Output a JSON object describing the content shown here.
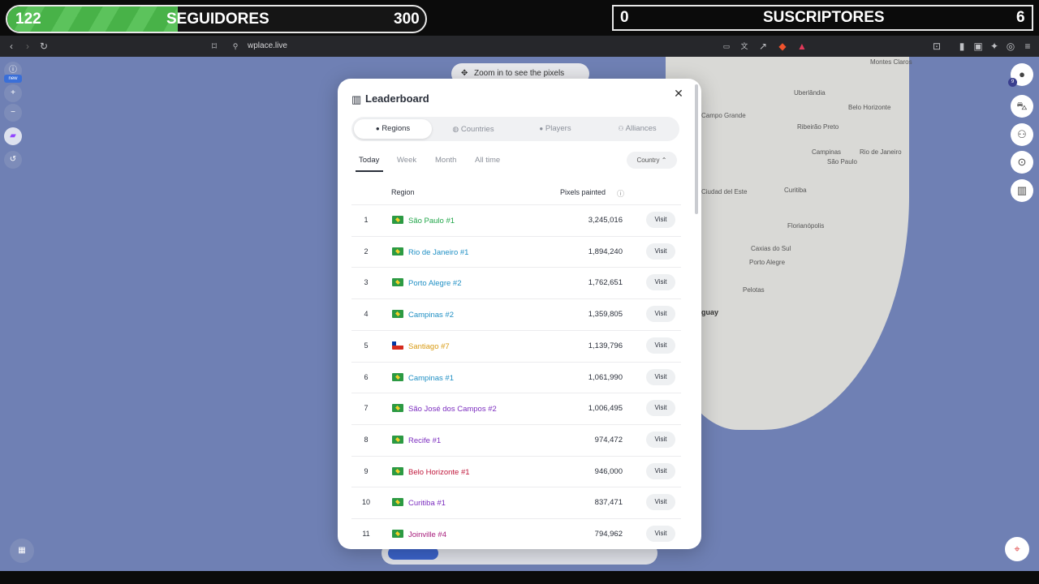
{
  "overlay": {
    "followers": {
      "current": "122",
      "label": "SEGUIDORES",
      "goal": "300",
      "progress": 0.407
    },
    "subscribers": {
      "current": "0",
      "label": "SUSCRIPTORES",
      "goal": "6"
    }
  },
  "browser": {
    "url": "wplace.live",
    "icons": [
      "back-icon",
      "forward-icon",
      "reload-icon",
      "bookmark-icon",
      "site-settings-icon",
      "cast-icon",
      "translate-icon",
      "share-icon",
      "brave-shield-icon",
      "rewards-icon",
      "tab-search-icon",
      "sidebar-icon",
      "wallet-icon",
      "leo-icon",
      "vpn-icon",
      "menu-icon"
    ]
  },
  "map": {
    "zoom_hint": "Zoom in to see the pixels",
    "cities": [
      "Montes Claros",
      "Uberlândia",
      "Belo Horizonte",
      "Campo Grande",
      "Ribeirão Preto",
      "Campinas",
      "Rio de Janeiro",
      "São Paulo",
      "Ciudad del Este",
      "Curitiba",
      "Florianópolis",
      "Caxias do Sul",
      "Porto Alegre",
      "Pelotas",
      "guay"
    ],
    "left_controls": [
      "info-icon",
      "new",
      "plus-icon",
      "minus-icon",
      "twitch-icon",
      "history-icon"
    ],
    "right_controls": [
      {
        "icon": "avatar-icon",
        "badge": "9"
      },
      {
        "icon": "cart-icon"
      },
      {
        "icon": "alliance-icon"
      },
      {
        "icon": "search-map-icon"
      },
      {
        "icon": "leaderboard-icon"
      }
    ]
  },
  "leaderboard": {
    "title": "Leaderboard",
    "close_icon": "close-icon",
    "tabs": [
      {
        "label": "Regions",
        "icon": "pin-icon",
        "active": true
      },
      {
        "label": "Countries",
        "icon": "globe-icon",
        "active": false
      },
      {
        "label": "Players",
        "icon": "person-icon",
        "active": false
      },
      {
        "label": "Alliances",
        "icon": "group-icon",
        "active": false
      }
    ],
    "periods": [
      {
        "label": "Today",
        "active": true
      },
      {
        "label": "Week",
        "active": false
      },
      {
        "label": "Month",
        "active": false
      },
      {
        "label": "All time",
        "active": false
      }
    ],
    "filter": "Country",
    "columns": {
      "region": "Region",
      "pixels": "Pixels painted"
    },
    "visit_label": "Visit",
    "rows": [
      {
        "rank": "1",
        "flag": "br",
        "name": "São Paulo #1",
        "color": "#22a64a",
        "pixels": "3,245,016"
      },
      {
        "rank": "2",
        "flag": "br",
        "name": "Rio de Janeiro #1",
        "color": "#1f8fc4",
        "pixels": "1,894,240"
      },
      {
        "rank": "3",
        "flag": "br",
        "name": "Porto Alegre #2",
        "color": "#1f8fc4",
        "pixels": "1,762,651"
      },
      {
        "rank": "4",
        "flag": "br",
        "name": "Campinas #2",
        "color": "#1f8fc4",
        "pixels": "1,359,805"
      },
      {
        "rank": "5",
        "flag": "cl",
        "name": "Santiago #7",
        "color": "#d89a12",
        "pixels": "1,139,796"
      },
      {
        "rank": "6",
        "flag": "br",
        "name": "Campinas #1",
        "color": "#1f8fc4",
        "pixels": "1,061,990"
      },
      {
        "rank": "7",
        "flag": "br",
        "name": "São José dos Campos #2",
        "color": "#7b2cbf",
        "pixels": "1,006,495"
      },
      {
        "rank": "8",
        "flag": "br",
        "name": "Recife #1",
        "color": "#7b2cbf",
        "pixels": "974,472"
      },
      {
        "rank": "9",
        "flag": "br",
        "name": "Belo Horizonte #1",
        "color": "#c0173b",
        "pixels": "946,000"
      },
      {
        "rank": "10",
        "flag": "br",
        "name": "Curitiba #1",
        "color": "#7b2cbf",
        "pixels": "837,471"
      },
      {
        "rank": "11",
        "flag": "br",
        "name": "Joinville #4",
        "color": "#a71d7c",
        "pixels": "794,962"
      }
    ]
  }
}
